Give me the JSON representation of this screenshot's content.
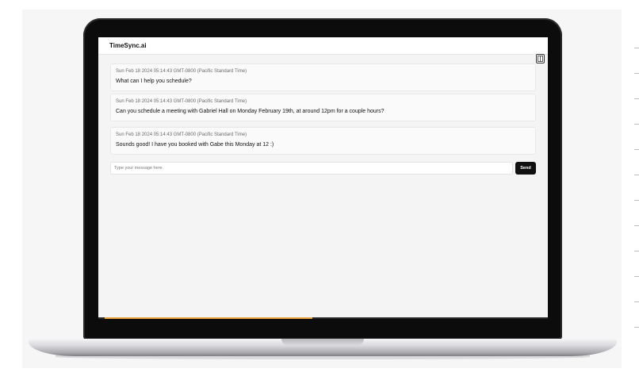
{
  "app": {
    "title": "TimeSync.ai"
  },
  "messages": [
    {
      "timestamp": "Sun Feb 18 2024 05:14:43 GMT-0800 (Pacific Standard Time)",
      "text": "What can I help you schedule?"
    },
    {
      "timestamp": "Sun Feb 18 2024 05:14:43 GMT-0800 (Pacific Standard Time)",
      "text": "Can you schedule a meeting with Gabriel Hall on Monday February 19th, at around 12pm for a couple hours?"
    },
    {
      "timestamp": "Sun Feb 18 2024 05:14:43 GMT-0800 (Pacific Standard Time)",
      "text": "Sounds good! I have you booked with Gabe this Monday at 12 :)"
    }
  ],
  "composer": {
    "value": "",
    "placeholder": "Type your message here.",
    "send_label": "Send"
  },
  "icons": {
    "sidebar_toggle": "sidebar-toggle-icon"
  },
  "colors": {
    "accent": "#111111",
    "progress": "#e9a23b"
  }
}
